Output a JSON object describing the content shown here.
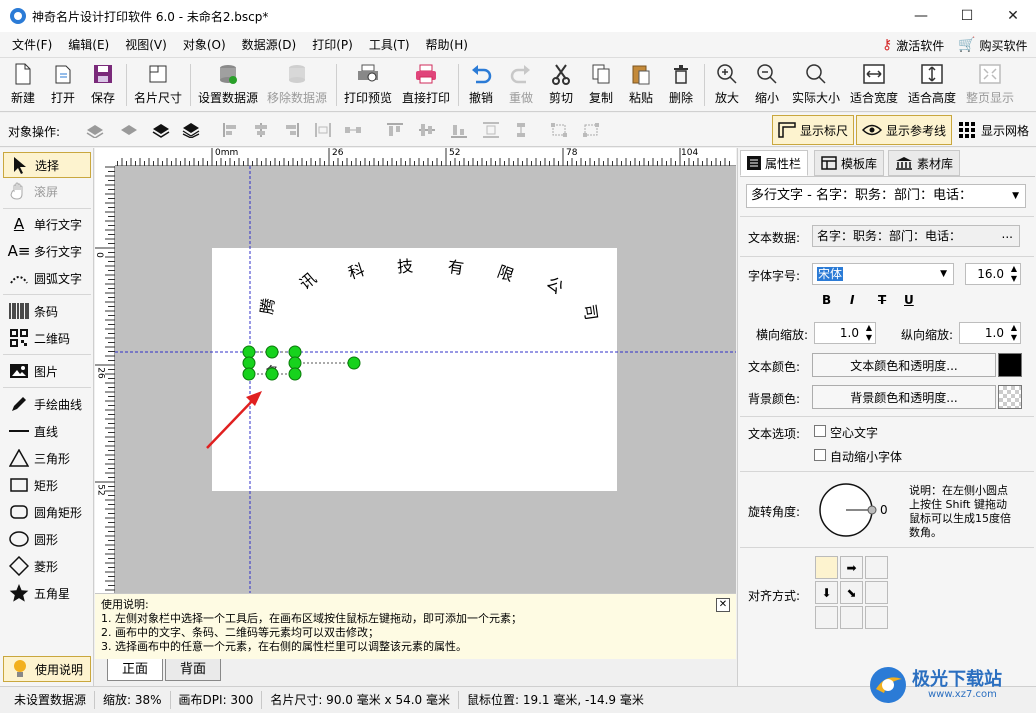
{
  "window": {
    "title": "神奇名片设计打印软件 6.0 - 未命名2.bscp*",
    "minimize": "—",
    "maximize": "☐",
    "close": "✕"
  },
  "menu": {
    "items": [
      "文件(F)",
      "编辑(E)",
      "视图(V)",
      "对象(O)",
      "数据源(D)",
      "打印(P)",
      "工具(T)",
      "帮助(H)"
    ],
    "activate": "激活软件",
    "buy": "购买软件"
  },
  "toolbar": {
    "new": "新建",
    "open": "打开",
    "save": "保存",
    "card_size": "名片尺寸",
    "set_datasource": "设置数据源",
    "remove_datasource": "移除数据源",
    "print_preview": "打印预览",
    "direct_print": "直接打印",
    "undo": "撤销",
    "redo": "重做",
    "cut": "剪切",
    "copy": "复制",
    "paste": "粘贴",
    "delete": "删除",
    "zoom_in": "放大",
    "zoom_out": "缩小",
    "actual_size": "实际大小",
    "fit_width": "适合宽度",
    "fit_height": "适合高度",
    "whole_page": "整页显示"
  },
  "objbar": {
    "label": "对象操作:",
    "show_ruler": "显示标尺",
    "show_guides": "显示参考线",
    "show_grid": "显示网格"
  },
  "palette": {
    "select": "选择",
    "scroll": "滚屏",
    "single_text": "单行文字",
    "multi_text": "多行文字",
    "arc_text": "圆弧文字",
    "barcode": "条码",
    "qrcode": "二维码",
    "image": "图片",
    "freehand": "手绘曲线",
    "line": "直线",
    "triangle": "三角形",
    "rectangle": "矩形",
    "rounded_rect": "圆角矩形",
    "circle": "圆形",
    "diamond": "菱形",
    "star": "五角星",
    "help": "使用说明"
  },
  "ruler": {
    "h_ticks": [
      "0mm",
      "26",
      "52",
      "78",
      "104"
    ],
    "v_ticks": [
      "0",
      "26",
      "52"
    ]
  },
  "card": {
    "arc_chars": [
      "腾",
      "讯",
      "科",
      "技",
      "有",
      "限",
      "公",
      "司"
    ]
  },
  "help": {
    "title": "使用说明:",
    "lines": [
      "1. 左侧对象栏中选择一个工具后，在画布区域按住鼠标左键拖动，即可添加一个元素；",
      "2. 画布中的文字、条码、二维码等元素均可以双击修改；",
      "3. 选择画布中的任意一个元素，在右侧的属性栏里可以调整该元素的属性。"
    ],
    "close": "✕"
  },
  "pagetabs": {
    "front": "正面",
    "back": "背面"
  },
  "rpanel": {
    "tabs": [
      "属性栏",
      "模板库",
      "素材库"
    ],
    "object_select": "多行文字 - 名字：职务：部门：电话：",
    "text_data_label": "文本数据:",
    "text_data_value": "名字：职务：部门：电话：",
    "more": "...",
    "font_label": "字体字号:",
    "font_value": "宋体",
    "font_size": "16.0",
    "bold": "B",
    "italic": "I",
    "strike": "T",
    "underline": "U",
    "hscale_label": "横向缩放:",
    "hscale_value": "1.0",
    "vscale_label": "纵向缩放:",
    "vscale_value": "1.0",
    "text_color_label": "文本颜色:",
    "text_color_btn": "文本颜色和透明度...",
    "bg_color_label": "背景颜色:",
    "bg_color_btn": "背景颜色和透明度...",
    "text_options_label": "文本选项:",
    "hollow_text": "空心文字",
    "auto_shrink": "自动缩小字体",
    "rotation_label": "旋转角度:",
    "rotation_value": "0",
    "rotation_note": [
      "说明：在左侧小圆点",
      "上按住 Shift 键拖动",
      "鼠标可以生成15度倍",
      "数角。"
    ],
    "align_label": "对齐方式:"
  },
  "status": {
    "datasource": "未设置数据源",
    "zoom": "缩放: 38%",
    "dpi": "画布DPI: 300",
    "card_size": "名片尺寸: 90.0 毫米 x 54.0 毫米",
    "mouse_pos": "鼠标位置: 19.1 毫米, -14.9 毫米"
  },
  "watermark": {
    "brand": "极光下载站",
    "url": "www.xz7.com"
  },
  "colors": {
    "accent": "#2b7bd6",
    "selection": "#fdf3cf",
    "handle": "#17d21d",
    "arrow": "#e02020"
  }
}
